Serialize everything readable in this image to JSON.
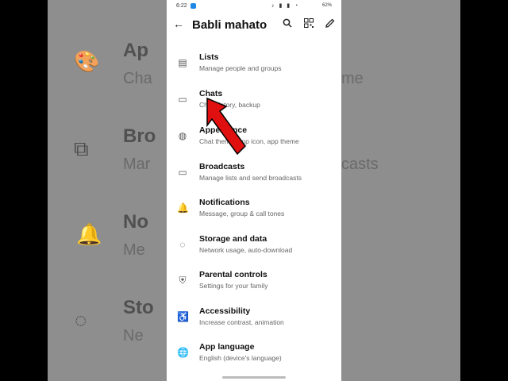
{
  "status": {
    "time": "6:22",
    "right": "62%"
  },
  "toolbar": {
    "title": "Babli mahato"
  },
  "items": [
    {
      "title": "Lists",
      "subtitle": "Manage people and groups",
      "icon": "lists-icon"
    },
    {
      "title": "Chats",
      "subtitle": "Chat history, backup",
      "icon": "chats-icon"
    },
    {
      "title": "Appearance",
      "subtitle": "Chat theme, app icon, app theme",
      "icon": "palette-icon"
    },
    {
      "title": "Broadcasts",
      "subtitle": "Manage lists and send broadcasts",
      "icon": "broadcast-icon"
    },
    {
      "title": "Notifications",
      "subtitle": "Message, group & call tones",
      "icon": "bell-icon"
    },
    {
      "title": "Storage and data",
      "subtitle": "Network usage, auto-download",
      "icon": "storage-icon"
    },
    {
      "title": "Parental controls",
      "subtitle": "Settings for your family",
      "icon": "shield-icon"
    },
    {
      "title": "Accessibility",
      "subtitle": "Increase contrast, animation",
      "icon": "accessibility-icon"
    },
    {
      "title": "App language",
      "subtitle": "English (device's language)",
      "icon": "globe-icon"
    }
  ],
  "background": {
    "left_rows": [
      "Ap",
      "Cha",
      "Bro",
      "Mar",
      "No",
      "Me",
      "Sto",
      "Ne"
    ],
    "right_rows": [
      "me",
      "casts",
      "",
      ""
    ]
  },
  "colors": {
    "arrow": "#e01010",
    "accent": "#1e88e5"
  }
}
